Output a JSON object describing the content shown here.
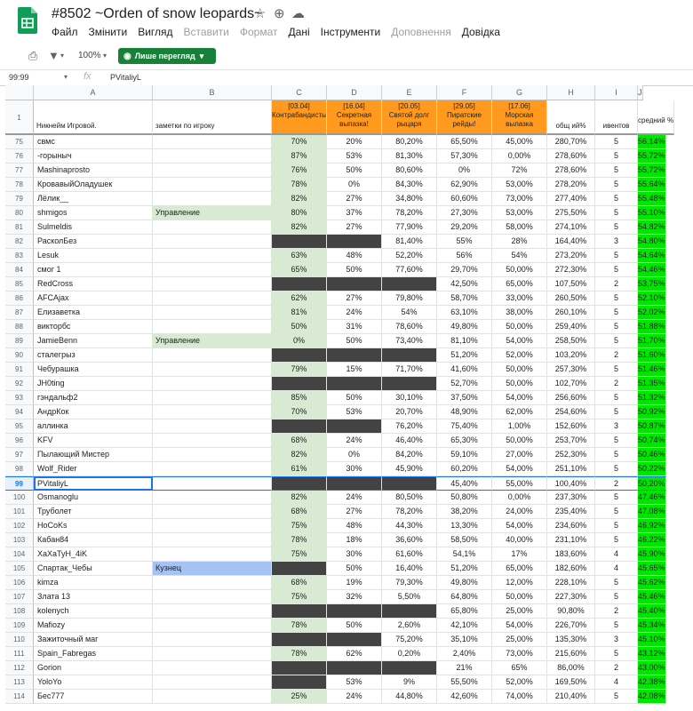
{
  "doc": {
    "title": "#8502 ~Orden of snow leopards~",
    "menu": [
      {
        "label": "Файл",
        "disabled": false
      },
      {
        "label": "Змінити",
        "disabled": false
      },
      {
        "label": "Вигляд",
        "disabled": false
      },
      {
        "label": "Вставити",
        "disabled": true
      },
      {
        "label": "Формат",
        "disabled": true
      },
      {
        "label": "Дані",
        "disabled": false
      },
      {
        "label": "Інструменти",
        "disabled": false
      },
      {
        "label": "Доповнення",
        "disabled": true
      },
      {
        "label": "Довідка",
        "disabled": false
      }
    ]
  },
  "toolbar": {
    "zoom": "100%",
    "view_only_label": "Лише перегляд"
  },
  "formula_bar": {
    "name_box": "99:99",
    "fx": "fx",
    "value": "PVitaliyL"
  },
  "columns": [
    "A",
    "B",
    "C",
    "D",
    "E",
    "F",
    "G",
    "H",
    "I",
    "J"
  ],
  "header_row": {
    "row_number": "1",
    "nickname": "Никнейм Игровой.",
    "notes": "заметки по игроку",
    "events": [
      {
        "date": "[03.04]",
        "name": "Контрабандисты"
      },
      {
        "date": "[16.04]",
        "name": "Секретная выпазка!"
      },
      {
        "date": "[20.05]",
        "name": "Святой долг рыцаря"
      },
      {
        "date": "[29.05]",
        "name": "Пиратские рейды!"
      },
      {
        "date": "[17.06]",
        "name": "Морская вылазка"
      }
    ],
    "total": "общ ий%",
    "count": "ивентов",
    "average": "средний %"
  },
  "rows": [
    {
      "n": "75",
      "nick": "свмс",
      "note": "",
      "note_color": "",
      "vals": [
        "70%",
        "20%",
        "80,20%",
        "65,50%",
        "45,00%"
      ],
      "dark": [
        false,
        false,
        false,
        false,
        false
      ],
      "total": "280,70%",
      "count": "5",
      "avg": "56,14%"
    },
    {
      "n": "76",
      "nick": "-горыныч",
      "note": "",
      "note_color": "",
      "vals": [
        "87%",
        "53%",
        "81,30%",
        "57,30%",
        "0,00%"
      ],
      "dark": [
        false,
        false,
        false,
        false,
        false
      ],
      "total": "278,60%",
      "count": "5",
      "avg": "55,72%"
    },
    {
      "n": "77",
      "nick": "Mashinaprosto",
      "note": "",
      "note_color": "",
      "vals": [
        "76%",
        "50%",
        "80,60%",
        "0%",
        "72%"
      ],
      "dark": [
        false,
        false,
        false,
        false,
        false
      ],
      "total": "278,60%",
      "count": "5",
      "avg": "55,72%"
    },
    {
      "n": "78",
      "nick": "КровавыйОладушек",
      "note": "",
      "note_color": "",
      "vals": [
        "78%",
        "0%",
        "84,30%",
        "62,90%",
        "53,00%"
      ],
      "dark": [
        false,
        false,
        false,
        false,
        false
      ],
      "total": "278,20%",
      "count": "5",
      "avg": "55,64%"
    },
    {
      "n": "79",
      "nick": "Лёлик__",
      "note": "",
      "note_color": "",
      "vals": [
        "82%",
        "27%",
        "34,80%",
        "60,60%",
        "73,00%"
      ],
      "dark": [
        false,
        false,
        false,
        false,
        false
      ],
      "total": "277,40%",
      "count": "5",
      "avg": "55,48%"
    },
    {
      "n": "80",
      "nick": "shmigos",
      "note": "Управление",
      "note_color": "green",
      "vals": [
        "80%",
        "37%",
        "78,20%",
        "27,30%",
        "53,00%"
      ],
      "dark": [
        false,
        false,
        false,
        false,
        false
      ],
      "total": "275,50%",
      "count": "5",
      "avg": "55,10%"
    },
    {
      "n": "81",
      "nick": "Sulmeldis",
      "note": "",
      "note_color": "",
      "vals": [
        "82%",
        "27%",
        "77,90%",
        "29,20%",
        "58,00%"
      ],
      "dark": [
        false,
        false,
        false,
        false,
        false
      ],
      "total": "274,10%",
      "count": "5",
      "avg": "54,82%"
    },
    {
      "n": "82",
      "nick": "РасколБез",
      "note": "",
      "note_color": "",
      "vals": [
        "",
        "",
        "81,40%",
        "55%",
        "28%"
      ],
      "dark": [
        true,
        true,
        false,
        false,
        false
      ],
      "total": "164,40%",
      "count": "3",
      "avg": "54,80%"
    },
    {
      "n": "83",
      "nick": "Lesuk",
      "note": "",
      "note_color": "",
      "vals": [
        "63%",
        "48%",
        "52,20%",
        "56%",
        "54%"
      ],
      "dark": [
        false,
        false,
        false,
        false,
        false
      ],
      "total": "273,20%",
      "count": "5",
      "avg": "54,64%"
    },
    {
      "n": "84",
      "nick": "смог 1",
      "note": "",
      "note_color": "",
      "vals": [
        "65%",
        "50%",
        "77,60%",
        "29,70%",
        "50,00%"
      ],
      "dark": [
        false,
        false,
        false,
        false,
        false
      ],
      "total": "272,30%",
      "count": "5",
      "avg": "54,46%"
    },
    {
      "n": "85",
      "nick": "RedCross",
      "note": "",
      "note_color": "",
      "vals": [
        "",
        "",
        "",
        "42,50%",
        "65,00%"
      ],
      "dark": [
        true,
        true,
        true,
        false,
        false
      ],
      "total": "107,50%",
      "count": "2",
      "avg": "53,75%"
    },
    {
      "n": "86",
      "nick": "AFCAjax",
      "note": "",
      "note_color": "",
      "vals": [
        "62%",
        "27%",
        "79,80%",
        "58,70%",
        "33,00%"
      ],
      "dark": [
        false,
        false,
        false,
        false,
        false
      ],
      "total": "260,50%",
      "count": "5",
      "avg": "52,10%"
    },
    {
      "n": "87",
      "nick": "Елизаветка",
      "note": "",
      "note_color": "",
      "vals": [
        "81%",
        "24%",
        "54%",
        "63,10%",
        "38,00%"
      ],
      "dark": [
        false,
        false,
        false,
        false,
        false
      ],
      "total": "260,10%",
      "count": "5",
      "avg": "52,02%"
    },
    {
      "n": "88",
      "nick": "викторбс",
      "note": "",
      "note_color": "",
      "vals": [
        "50%",
        "31%",
        "78,60%",
        "49,80%",
        "50,00%"
      ],
      "dark": [
        false,
        false,
        false,
        false,
        false
      ],
      "total": "259,40%",
      "count": "5",
      "avg": "51,88%"
    },
    {
      "n": "89",
      "nick": "JamieBenn",
      "note": "Управление",
      "note_color": "green",
      "vals": [
        "0%",
        "50%",
        "73,40%",
        "81,10%",
        "54,00%"
      ],
      "dark": [
        false,
        false,
        false,
        false,
        false
      ],
      "total": "258,50%",
      "count": "5",
      "avg": "51,70%"
    },
    {
      "n": "90",
      "nick": "сталегрыз",
      "note": "",
      "note_color": "",
      "vals": [
        "",
        "",
        "",
        "51,20%",
        "52,00%"
      ],
      "dark": [
        true,
        true,
        true,
        false,
        false
      ],
      "total": "103,20%",
      "count": "2",
      "avg": "51,60%"
    },
    {
      "n": "91",
      "nick": "Чебурашка",
      "note": "",
      "note_color": "",
      "vals": [
        "79%",
        "15%",
        "71,70%",
        "41,60%",
        "50,00%"
      ],
      "dark": [
        false,
        false,
        false,
        false,
        false
      ],
      "total": "257,30%",
      "count": "5",
      "avg": "51,46%"
    },
    {
      "n": "92",
      "nick": "JH0ting",
      "note": "",
      "note_color": "",
      "vals": [
        "",
        "",
        "",
        "52,70%",
        "50,00%"
      ],
      "dark": [
        true,
        true,
        true,
        false,
        false
      ],
      "total": "102,70%",
      "count": "2",
      "avg": "51,35%"
    },
    {
      "n": "93",
      "nick": "гэндальф2",
      "note": "",
      "note_color": "",
      "vals": [
        "85%",
        "50%",
        "30,10%",
        "37,50%",
        "54,00%"
      ],
      "dark": [
        false,
        false,
        false,
        false,
        false
      ],
      "total": "256,60%",
      "count": "5",
      "avg": "51,32%"
    },
    {
      "n": "94",
      "nick": "АндрКок",
      "note": "",
      "note_color": "",
      "vals": [
        "70%",
        "53%",
        "20,70%",
        "48,90%",
        "62,00%"
      ],
      "dark": [
        false,
        false,
        false,
        false,
        false
      ],
      "total": "254,60%",
      "count": "5",
      "avg": "50,92%"
    },
    {
      "n": "95",
      "nick": "аллинка",
      "note": "",
      "note_color": "",
      "vals": [
        "",
        "",
        "76,20%",
        "75,40%",
        "1,00%"
      ],
      "dark": [
        true,
        true,
        false,
        false,
        false
      ],
      "total": "152,60%",
      "count": "3",
      "avg": "50,87%"
    },
    {
      "n": "96",
      "nick": "KFV",
      "note": "",
      "note_color": "",
      "vals": [
        "68%",
        "24%",
        "46,40%",
        "65,30%",
        "50,00%"
      ],
      "dark": [
        false,
        false,
        false,
        false,
        false
      ],
      "total": "253,70%",
      "count": "5",
      "avg": "50,74%"
    },
    {
      "n": "97",
      "nick": "Пылающий Мистер",
      "note": "",
      "note_color": "",
      "vals": [
        "82%",
        "0%",
        "84,20%",
        "59,10%",
        "27,00%"
      ],
      "dark": [
        false,
        false,
        false,
        false,
        false
      ],
      "total": "252,30%",
      "count": "5",
      "avg": "50,46%"
    },
    {
      "n": "98",
      "nick": "Wolf_Rider",
      "note": "",
      "note_color": "",
      "vals": [
        "61%",
        "30%",
        "45,90%",
        "60,20%",
        "54,00%"
      ],
      "dark": [
        false,
        false,
        false,
        false,
        false
      ],
      "total": "251,10%",
      "count": "5",
      "avg": "50,22%"
    },
    {
      "n": "99",
      "nick": "PVitaliyL",
      "note": "",
      "note_color": "",
      "vals": [
        "",
        "",
        "",
        "45,40%",
        "55,00%"
      ],
      "dark": [
        true,
        true,
        true,
        false,
        false
      ],
      "total": "100,40%",
      "count": "2",
      "avg": "50,20%",
      "selected": true
    },
    {
      "n": "100",
      "nick": "Osmanoglu",
      "note": "",
      "note_color": "",
      "vals": [
        "82%",
        "24%",
        "80,50%",
        "50,80%",
        "0,00%"
      ],
      "dark": [
        false,
        false,
        false,
        false,
        false
      ],
      "total": "237,30%",
      "count": "5",
      "avg": "47,46%"
    },
    {
      "n": "101",
      "nick": "Труболет",
      "note": "",
      "note_color": "",
      "vals": [
        "68%",
        "27%",
        "78,20%",
        "38,20%",
        "24,00%"
      ],
      "dark": [
        false,
        false,
        false,
        false,
        false
      ],
      "total": "235,40%",
      "count": "5",
      "avg": "47,08%"
    },
    {
      "n": "102",
      "nick": "HoCoKs",
      "note": "",
      "note_color": "",
      "vals": [
        "75%",
        "48%",
        "44,30%",
        "13,30%",
        "54,00%"
      ],
      "dark": [
        false,
        false,
        false,
        false,
        false
      ],
      "total": "234,60%",
      "count": "5",
      "avg": "46,92%"
    },
    {
      "n": "103",
      "nick": "Кабан84",
      "note": "",
      "note_color": "",
      "vals": [
        "78%",
        "18%",
        "36,60%",
        "58,50%",
        "40,00%"
      ],
      "dark": [
        false,
        false,
        false,
        false,
        false
      ],
      "total": "231,10%",
      "count": "5",
      "avg": "46,22%"
    },
    {
      "n": "104",
      "nick": "ХаХаТуН_4iK",
      "note": "",
      "note_color": "",
      "vals": [
        "75%",
        "30%",
        "61,60%",
        "54,1%",
        "17%"
      ],
      "dark": [
        false,
        false,
        false,
        false,
        false
      ],
      "total": "183,60%",
      "count": "4",
      "avg": "45,90%"
    },
    {
      "n": "105",
      "nick": "Спартак_Чебы",
      "note": "Кузнец",
      "note_color": "blue",
      "vals": [
        "",
        "50%",
        "16,40%",
        "51,20%",
        "65,00%"
      ],
      "dark": [
        true,
        false,
        false,
        false,
        false
      ],
      "total": "182,60%",
      "count": "4",
      "avg": "45,65%"
    },
    {
      "n": "106",
      "nick": "kimza",
      "note": "",
      "note_color": "",
      "vals": [
        "68%",
        "19%",
        "79,30%",
        "49,80%",
        "12,00%"
      ],
      "dark": [
        false,
        false,
        false,
        false,
        false
      ],
      "total": "228,10%",
      "count": "5",
      "avg": "45,62%"
    },
    {
      "n": "107",
      "nick": "Злата 13",
      "note": "",
      "note_color": "",
      "vals": [
        "75%",
        "32%",
        "5,50%",
        "64,80%",
        "50,00%"
      ],
      "dark": [
        false,
        false,
        false,
        false,
        false
      ],
      "total": "227,30%",
      "count": "5",
      "avg": "45,46%"
    },
    {
      "n": "108",
      "nick": "kolenych",
      "note": "",
      "note_color": "",
      "vals": [
        "",
        "",
        "",
        "65,80%",
        "25,00%"
      ],
      "dark": [
        true,
        true,
        true,
        false,
        false
      ],
      "total": "90,80%",
      "count": "2",
      "avg": "45,40%"
    },
    {
      "n": "109",
      "nick": "Mafiozy",
      "note": "",
      "note_color": "",
      "vals": [
        "78%",
        "50%",
        "2,60%",
        "42,10%",
        "54,00%"
      ],
      "dark": [
        false,
        false,
        false,
        false,
        false
      ],
      "total": "226,70%",
      "count": "5",
      "avg": "45,34%"
    },
    {
      "n": "110",
      "nick": "Зажиточный маг",
      "note": "",
      "note_color": "",
      "vals": [
        "",
        "",
        "75,20%",
        "35,10%",
        "25,00%"
      ],
      "dark": [
        true,
        true,
        false,
        false,
        false
      ],
      "total": "135,30%",
      "count": "3",
      "avg": "45,10%"
    },
    {
      "n": "111",
      "nick": "Spain_Fabregas",
      "note": "",
      "note_color": "",
      "vals": [
        "78%",
        "62%",
        "0,20%",
        "2,40%",
        "73,00%"
      ],
      "dark": [
        false,
        false,
        false,
        false,
        false
      ],
      "total": "215,60%",
      "count": "5",
      "avg": "43,12%"
    },
    {
      "n": "112",
      "nick": "Gorion",
      "note": "",
      "note_color": "",
      "vals": [
        "",
        "",
        "",
        "21%",
        "65%"
      ],
      "dark": [
        true,
        true,
        true,
        false,
        false
      ],
      "total": "86,00%",
      "count": "2",
      "avg": "43,00%"
    },
    {
      "n": "113",
      "nick": "YoloYo",
      "note": "",
      "note_color": "",
      "vals": [
        "",
        "53%",
        "9%",
        "55,50%",
        "52,00%"
      ],
      "dark": [
        true,
        false,
        false,
        false,
        false
      ],
      "total": "169,50%",
      "count": "4",
      "avg": "42,38%"
    },
    {
      "n": "114",
      "nick": "Бес777",
      "note": "",
      "note_color": "",
      "vals": [
        "25%",
        "24%",
        "44,80%",
        "42,60%",
        "74,00%"
      ],
      "dark": [
        false,
        false,
        false,
        false,
        false
      ],
      "total": "210,40%",
      "count": "5",
      "avg": "42,08%"
    }
  ],
  "colors": {
    "event_header": "#ff9a1f",
    "avg_green": "#00e600",
    "col_c_green": "#d9ead3",
    "missing_dark": "#434343",
    "selection_blue": "#1a73e8",
    "view_only_green": "#188038"
  }
}
